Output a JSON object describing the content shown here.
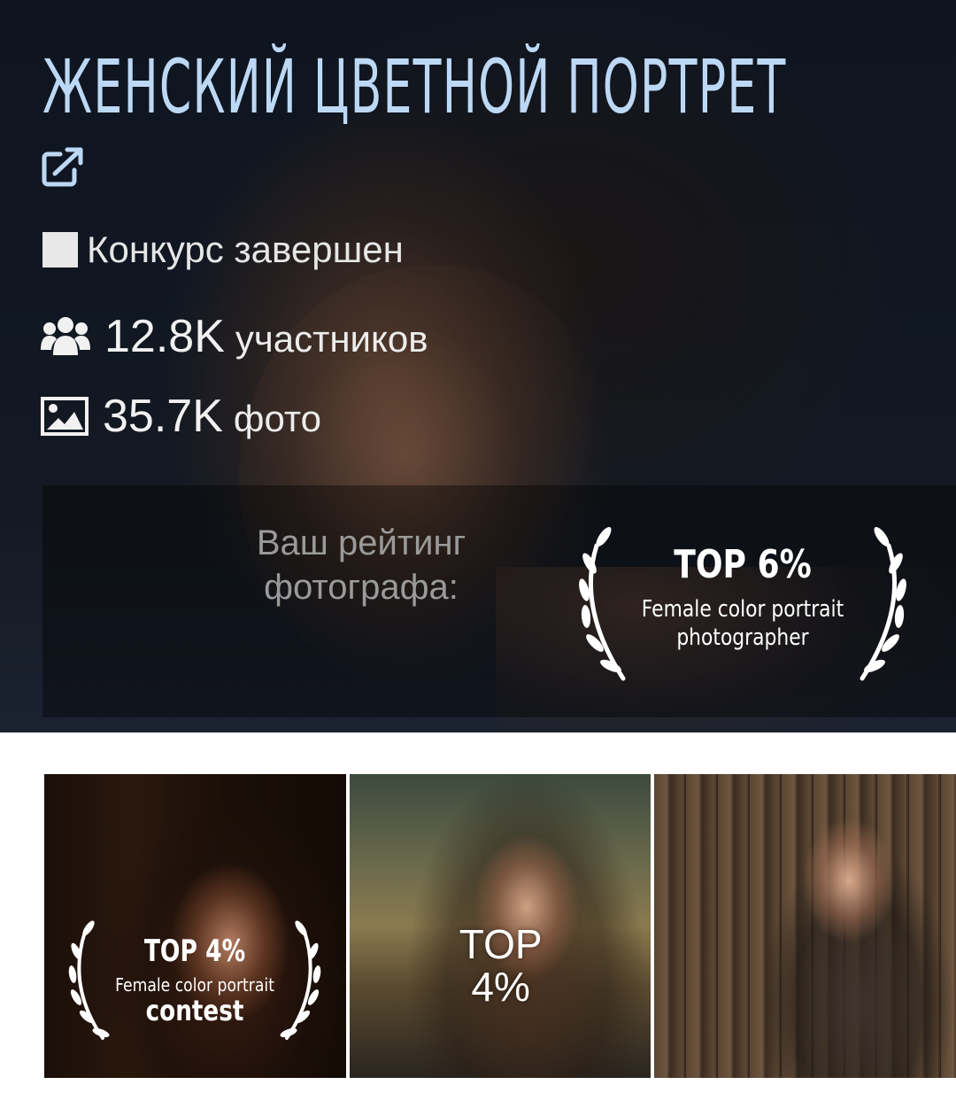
{
  "hero": {
    "title": "ЖЕНСКИЙ ЦВЕТНОЙ ПОРТРЕТ",
    "share_icon": "external-link-icon",
    "status": "Конкурс завершен",
    "participants_value": "12.8K",
    "participants_label": "участников",
    "photos_value": "35.7K",
    "photos_label": "фото",
    "rating_label": "Ваш рейтинг фотографа:",
    "rating_badge": {
      "title": "TOP 6%",
      "line1": "Female color portrait",
      "line2": "photographer"
    }
  },
  "thumbnails": [
    {
      "badge_title": "TOP 4%",
      "badge_line1": "Female color portrait",
      "badge_line2": "contest"
    },
    {
      "top_line1": "TOP",
      "top_line2": "4%"
    },
    {}
  ],
  "colors": {
    "title": "#bcd8f5",
    "background": "#ffffff"
  }
}
